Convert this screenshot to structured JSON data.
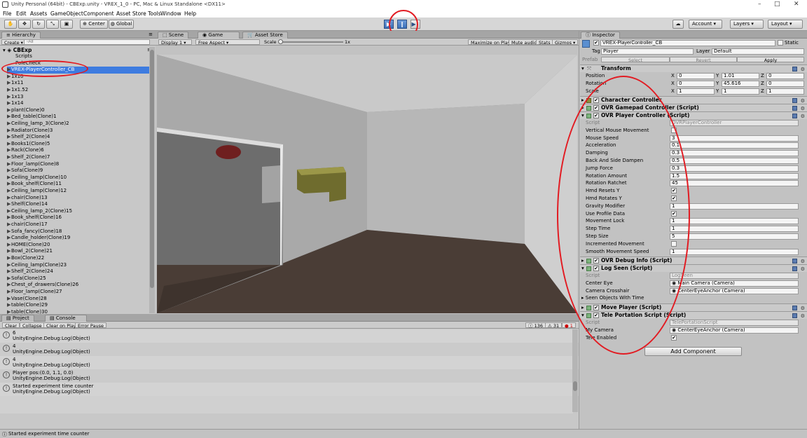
{
  "window": {
    "title": "Unity Personal (64bit) - CBExp.unity - VREX_1_0 - PC, Mac & Linux Standalone <DX11>",
    "minimize": "–",
    "maximize": "□",
    "close": "✕"
  },
  "menu": [
    "File",
    "Edit",
    "Assets",
    "GameObject",
    "Component",
    "Asset Store Tools",
    "Window",
    "Help"
  ],
  "toolbar": {
    "pivot": "Center",
    "space": "Global",
    "play": "▶",
    "pause": "‖",
    "step": "▶│",
    "account": "Account",
    "layers": "Layers",
    "layout": "Layout"
  },
  "hierarchy": {
    "tab": "Hierarchy",
    "create": "Create",
    "search_placeholder": "◦All",
    "root": "CBExp",
    "items": [
      {
        "label": "Scripts",
        "arrow": ""
      },
      {
        "label": "PoleCheck",
        "arrow": ""
      },
      {
        "label": "VREX-PlayerController_CB",
        "arrow": "▶",
        "selected": true
      },
      {
        "label": "1x10",
        "arrow": "▶"
      },
      {
        "label": "1x11",
        "arrow": "▶"
      },
      {
        "label": "1x1.52",
        "arrow": "▶"
      },
      {
        "label": "1x13",
        "arrow": "▶"
      },
      {
        "label": "1x14",
        "arrow": "▶"
      },
      {
        "label": "plant(Clone)0",
        "arrow": "▶"
      },
      {
        "label": "Bed_table(Clone)1",
        "arrow": "▶"
      },
      {
        "label": "Ceiling_lamp_3(Clone)2",
        "arrow": "▶"
      },
      {
        "label": "Radiator(Clone)3",
        "arrow": "▶"
      },
      {
        "label": "Shelf_2(Clone)4",
        "arrow": "▶"
      },
      {
        "label": "Books1(Clone)5",
        "arrow": "▶"
      },
      {
        "label": "Rack(Clone)6",
        "arrow": "▶"
      },
      {
        "label": "Shelf_2(Clone)7",
        "arrow": "▶"
      },
      {
        "label": "Floor_lamp(Clone)8",
        "arrow": "▶"
      },
      {
        "label": "Sofa(Clone)9",
        "arrow": "▶"
      },
      {
        "label": "Ceiling_lamp(Clone)10",
        "arrow": "▶"
      },
      {
        "label": "Book_shelf(Clone)11",
        "arrow": "▶"
      },
      {
        "label": "Ceiling_lamp(Clone)12",
        "arrow": "▶"
      },
      {
        "label": "chair(Clone)13",
        "arrow": "▶"
      },
      {
        "label": "Shelf(Clone)14",
        "arrow": "▶"
      },
      {
        "label": "Ceiling_lamp_2(Clone)15",
        "arrow": "▶"
      },
      {
        "label": "Book_shelf(Clone)16",
        "arrow": "▶"
      },
      {
        "label": "chair(Clone)17",
        "arrow": "▶"
      },
      {
        "label": "Sofa_fancy(Clone)18",
        "arrow": "▶"
      },
      {
        "label": "Candle_holder(Clone)19",
        "arrow": "▶"
      },
      {
        "label": "HOME(Clone)20",
        "arrow": "▶"
      },
      {
        "label": "Bowl_2(Clone)21",
        "arrow": "▶"
      },
      {
        "label": "Box(Clone)22",
        "arrow": "▶"
      },
      {
        "label": "Ceiling_lamp(Clone)23",
        "arrow": "▶"
      },
      {
        "label": "Shelf_2(Clone)24",
        "arrow": "▶"
      },
      {
        "label": "Sofa(Clone)25",
        "arrow": "▶"
      },
      {
        "label": "Chest_of_drawers(Clone)26",
        "arrow": "▶"
      },
      {
        "label": "Floor_lamp(Clone)27",
        "arrow": "▶"
      },
      {
        "label": "Vase(Clone)28",
        "arrow": "▶"
      },
      {
        "label": "table(Clone)29",
        "arrow": "▶"
      },
      {
        "label": "table(Clone)30",
        "arrow": "▶"
      }
    ]
  },
  "view_tabs": {
    "scene": "Scene",
    "game": "Game",
    "asset_store": "Asset Store"
  },
  "game_bar": {
    "display": "Display 1",
    "aspect": "Free Aspect",
    "scale_label": "Scale",
    "scale_value": "1x",
    "maximize": "Maximize on Play",
    "mute": "Mute audio",
    "stats": "Stats",
    "gizmos": "Gizmos"
  },
  "bottom_tabs": {
    "project": "Project",
    "console": "Console"
  },
  "console": {
    "clear": "Clear",
    "collapse": "Collapse",
    "clear_on_play": "Clear on Play",
    "error_pause": "Error Pause",
    "log_count": "136",
    "warn_count": "31",
    "err_count": "1",
    "entries": [
      {
        "line1": "6",
        "line2": "UnityEngine.Debug:Log(Object)"
      },
      {
        "line1": "4",
        "line2": "UnityEngine.Debug:Log(Object)"
      },
      {
        "line1": "4",
        "line2": "UnityEngine.Debug:Log(Object)"
      },
      {
        "line1": "Player pos:(0.0, 1.1, 0.0)",
        "line2": "UnityEngine.Debug:Log(Object)"
      },
      {
        "line1": "Started experiment time counter",
        "line2": "UnityEngine.Debug:Log(Object)"
      }
    ]
  },
  "status_bar": "Started experiment time counter",
  "inspector": {
    "tab": "Inspector",
    "object_name": "VREX-PlayerController_CB",
    "static": "Static",
    "tag_label": "Tag",
    "tag_value": "Player",
    "layer_label": "Layer",
    "layer_value": "Default",
    "prefab_label": "Prefab",
    "prefab_select": "Select",
    "prefab_revert": "Revert",
    "prefab_apply": "Apply",
    "transform": {
      "title": "Transform",
      "position_label": "Position",
      "rotation_label": "Rotation",
      "scale_label": "Scale",
      "position": [
        "0",
        "1.01",
        "0"
      ],
      "rotation": [
        "0",
        "45.616",
        "0"
      ],
      "scale": [
        "1",
        "1",
        "1"
      ]
    },
    "components": {
      "character_controller": "Character Controller",
      "gamepad": "OVR Gamepad Controller (Script)",
      "player_controller": "OVR Player Controller (Script)",
      "debug_info": "OVR Debug Info (Script)",
      "log_seen": "Log Seen (Script)",
      "move_player": "Move Player (Script)",
      "tele_portation": "Tele Portation Script (Script)"
    },
    "ovr_props": [
      {
        "label": "Script",
        "value": "OVRPlayerController",
        "kind": "script"
      },
      {
        "label": "Vertical Mouse Movement",
        "value": "",
        "kind": "check"
      },
      {
        "label": "Mouse Speed",
        "value": "3",
        "kind": "field"
      },
      {
        "label": "Acceleration",
        "value": "0.1",
        "kind": "field"
      },
      {
        "label": "Damping",
        "value": "0.3",
        "kind": "field"
      },
      {
        "label": "Back And Side Dampen",
        "value": "0.5",
        "kind": "field"
      },
      {
        "label": "Jump Force",
        "value": "0.3",
        "kind": "field"
      },
      {
        "label": "Rotation Amount",
        "value": "1.5",
        "kind": "field"
      },
      {
        "label": "Rotation Ratchet",
        "value": "45",
        "kind": "field"
      },
      {
        "label": "Hmd Resets Y",
        "value": "✔",
        "kind": "check"
      },
      {
        "label": "Hmd Rotates Y",
        "value": "✔",
        "kind": "check"
      },
      {
        "label": "Gravity Modifier",
        "value": "1",
        "kind": "field"
      },
      {
        "label": "Use Profile Data",
        "value": "✔",
        "kind": "check"
      },
      {
        "label": "Movement Lock",
        "value": "1",
        "kind": "field"
      },
      {
        "label": "Step Time",
        "value": "1",
        "kind": "field"
      },
      {
        "label": "Step Size",
        "value": "5",
        "kind": "field"
      },
      {
        "label": "Incremented Movement",
        "value": "",
        "kind": "check"
      },
      {
        "label": "Smooth Movement Speed",
        "value": "1",
        "kind": "field"
      }
    ],
    "log_seen_props": {
      "script_label": "Script",
      "script_value": "LogSeen",
      "center_eye_label": "Center Eye",
      "center_eye_value": "Main Camera (Camera)",
      "crosshair_label": "Camera Crosshair",
      "crosshair_value": "CenterEyeAnchor (Camera)",
      "seen_label": "Seen Objects With Time"
    },
    "tele_props": {
      "script_label": "Script",
      "script_value": "TelePortationScript",
      "camera_label": "My Camera",
      "camera_value": "CenterEyeAnchor (Camera)",
      "enabled_label": "Tele Enabled",
      "enabled_value": "✔"
    },
    "add_component": "Add Component"
  },
  "colors": {
    "annotation": "#e21b22",
    "selection": "#3e7ce0",
    "play_active": "#3a6fb8"
  }
}
